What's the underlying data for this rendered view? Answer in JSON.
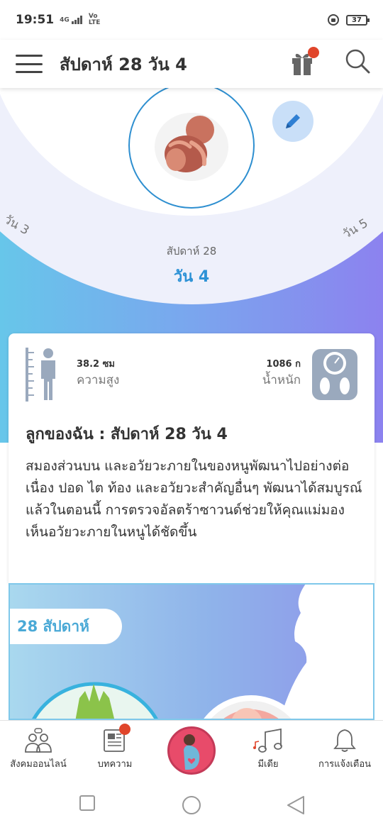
{
  "status_bar": {
    "time": "19:51",
    "network": "4G",
    "volte_1": "Vo",
    "volte_2": "LTE",
    "battery": "37"
  },
  "header": {
    "title": "สัปดาห์ 28 วัน 4"
  },
  "hero": {
    "prev_day": "วัน 3",
    "next_day": "วัน 5",
    "week_label": "สัปดาห์ 28",
    "current_day": "วัน 4"
  },
  "stats": {
    "height_value": "38.2 ซม",
    "height_label": "ความสูง",
    "weight_value": "1086 ก",
    "weight_label": "น้ำหนัก"
  },
  "card": {
    "title": "ลูกของฉัน : สัปดาห์ 28 วัน 4",
    "body": "สมองส่วนบน และอวัยวะภายในของหนูพัฒนาไปอย่างต่อเนื่อง ปอด ไต ท้อง และอวัยวะสำคัญอื่นๆ พัฒนาได้สมบูรณ์แล้วในตอนนี้ การตรวจอัลตร้าซาวนด์ช่วยให้คุณแม่มองเห็นอวัยวะภายในหนูได้ชัดขึ้น"
  },
  "banner": {
    "week_badge": "28 สัปดาห์"
  },
  "bottom_nav": {
    "items": [
      {
        "label": "สังคมออนไลน์",
        "icon": "community-icon"
      },
      {
        "label": "บทความ",
        "icon": "article-icon"
      },
      {
        "label": "",
        "icon": "pregnancy-icon"
      },
      {
        "label": "มีเดีย",
        "icon": "music-icon"
      },
      {
        "label": "การแจ้งเตือน",
        "icon": "bell-icon"
      }
    ]
  },
  "colors": {
    "accent_blue": "#2d92d6",
    "notification_dot": "#e0452b",
    "center_button": "#e84b6a"
  }
}
